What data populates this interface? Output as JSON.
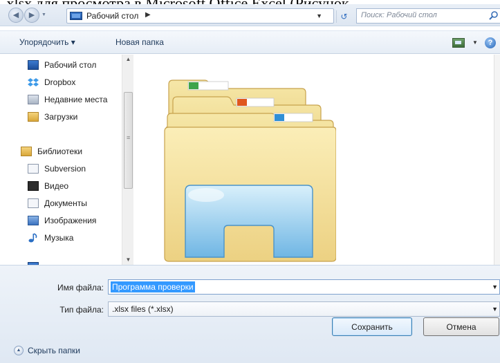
{
  "caption": ".xlsx для просмотра в Microsoft Office Excel (Рисунок",
  "address_bar": {
    "location": "Рабочий стол",
    "search_placeholder": "Поиск: Рабочий стол"
  },
  "toolbar": {
    "organize_label": "Упорядочить ▾",
    "new_folder_label": "Новая папка"
  },
  "nav_pane": {
    "favorites": [
      {
        "label": "Рабочий стол",
        "icon": "desktop-icon"
      },
      {
        "label": "Dropbox",
        "icon": "dropbox-icon"
      },
      {
        "label": "Недавние места",
        "icon": "recent-places-icon"
      },
      {
        "label": "Загрузки",
        "icon": "downloads-icon"
      }
    ],
    "libraries_label": "Библиотеки",
    "libraries": [
      {
        "label": "Subversion",
        "icon": "document-icon"
      },
      {
        "label": "Видео",
        "icon": "video-icon"
      },
      {
        "label": "Документы",
        "icon": "document-icon"
      },
      {
        "label": "Изображения",
        "icon": "images-icon"
      },
      {
        "label": "Музыка",
        "icon": "music-icon"
      }
    ]
  },
  "form": {
    "filename_label": "Имя файла:",
    "filename_value": "Программа проверки",
    "filetype_label": "Тип файла:",
    "filetype_value": ".xlsx files (*.xlsx)"
  },
  "footer": {
    "hide_folders_label": "Скрыть папки",
    "save_label": "Сохранить",
    "cancel_label": "Отмена"
  }
}
